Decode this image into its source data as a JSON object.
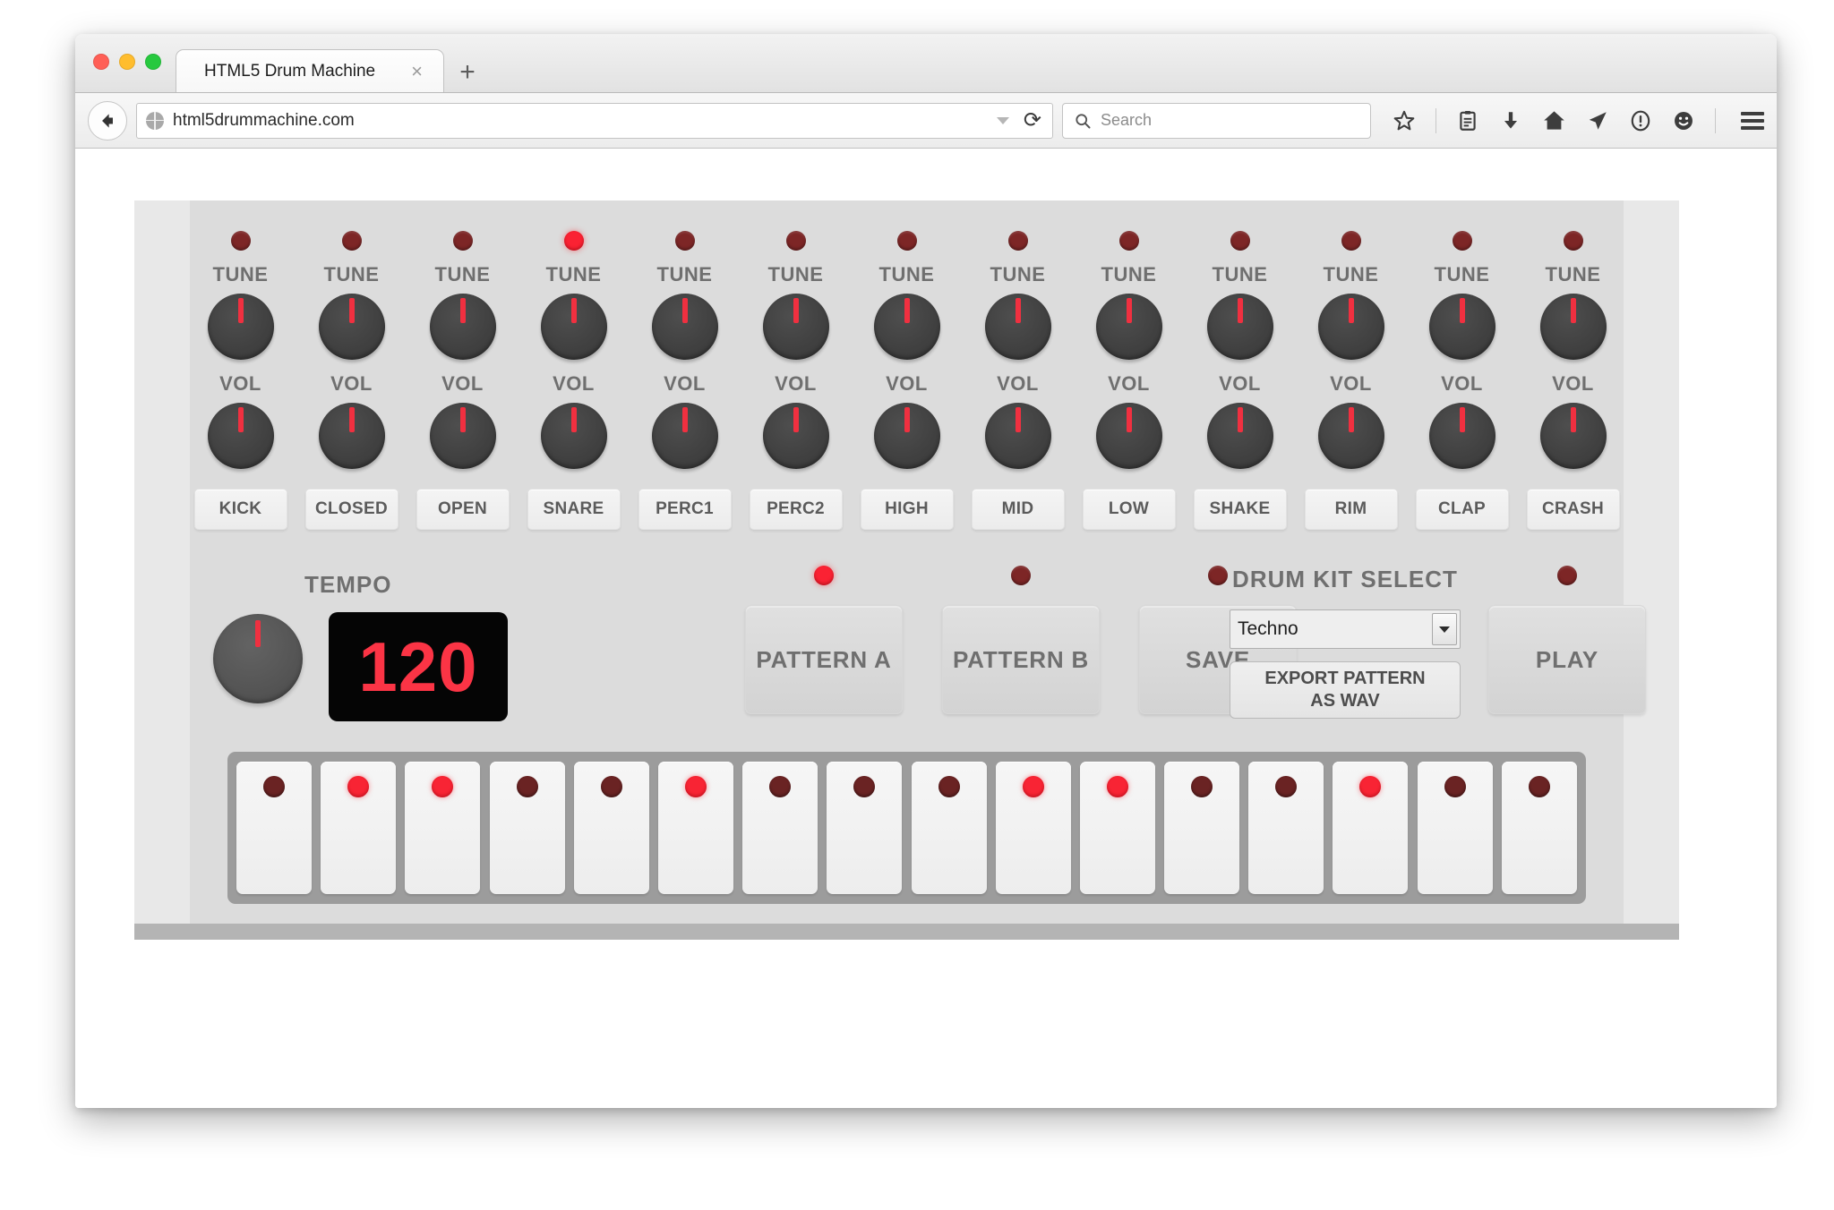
{
  "browser": {
    "tab_title": "HTML5 Drum Machine",
    "tab_close_label": "×",
    "new_tab_label": "+",
    "url": "html5drummachine.com",
    "reload_label": "⟳",
    "search_placeholder": "Search",
    "toolbar_icons": [
      "star-icon",
      "reading-list-icon",
      "download-icon",
      "home-icon",
      "share-icon",
      "info-icon",
      "smiley-icon",
      "hamburger-menu-icon"
    ]
  },
  "machine": {
    "tune_label": "TUNE",
    "vol_label": "VOL",
    "channels": [
      {
        "name": "KICK",
        "led_on": false
      },
      {
        "name": "CLOSED",
        "led_on": false
      },
      {
        "name": "OPEN",
        "led_on": false
      },
      {
        "name": "SNARE",
        "led_on": true
      },
      {
        "name": "PERC1",
        "led_on": false
      },
      {
        "name": "PERC2",
        "led_on": false
      },
      {
        "name": "HIGH",
        "led_on": false
      },
      {
        "name": "MID",
        "led_on": false
      },
      {
        "name": "LOW",
        "led_on": false
      },
      {
        "name": "SHAKE",
        "led_on": false
      },
      {
        "name": "RIM",
        "led_on": false
      },
      {
        "name": "CLAP",
        "led_on": false
      },
      {
        "name": "CRASH",
        "led_on": false
      }
    ],
    "tempo": {
      "label": "TEMPO",
      "value": "120"
    },
    "transport": [
      {
        "label": "PATTERN A",
        "led_on": true
      },
      {
        "label": "PATTERN B",
        "led_on": false
      },
      {
        "label": "SAVE",
        "led_on": false
      }
    ],
    "play": {
      "label": "PLAY",
      "led_on": false
    },
    "drum_kit": {
      "label": "DRUM KIT SELECT",
      "selected": "Techno",
      "export_line1": "EXPORT PATTERN",
      "export_line2": "AS WAV"
    },
    "sequencer": {
      "steps": [
        {
          "index": 1,
          "on": false
        },
        {
          "index": 2,
          "on": true
        },
        {
          "index": 3,
          "on": true
        },
        {
          "index": 4,
          "on": false
        },
        {
          "index": 5,
          "on": false
        },
        {
          "index": 6,
          "on": true
        },
        {
          "index": 7,
          "on": false
        },
        {
          "index": 8,
          "on": false
        },
        {
          "index": 9,
          "on": false
        },
        {
          "index": 10,
          "on": true
        },
        {
          "index": 11,
          "on": true
        },
        {
          "index": 12,
          "on": false
        },
        {
          "index": 13,
          "on": false
        },
        {
          "index": 14,
          "on": true
        },
        {
          "index": 15,
          "on": false
        },
        {
          "index": 16,
          "on": false
        }
      ]
    },
    "colors": {
      "panel": "#dcdcdc",
      "panel_outer": "#e8e8e8",
      "panel_base": "#b4b4b4",
      "led_on": "#fa2233",
      "led_off": "#7d2626",
      "knob": "#414141",
      "knob_indicator": "#f03040",
      "display_bg": "#050505",
      "display_text": "#fb3445",
      "sequencer_frame": "#9c9c9c",
      "label_text": "#6f6f6f"
    }
  }
}
